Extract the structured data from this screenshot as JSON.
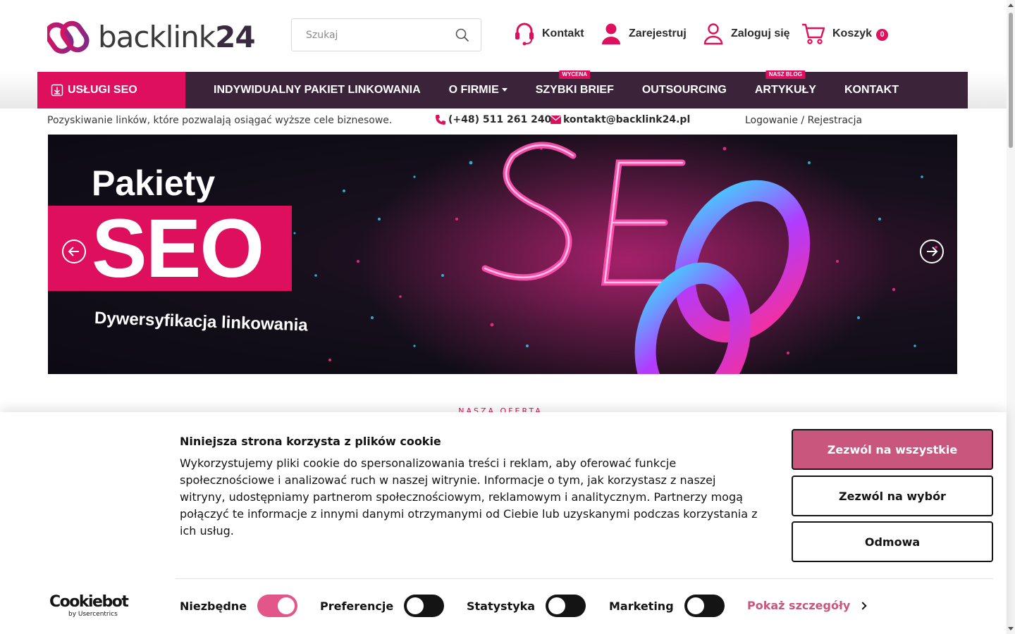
{
  "brand": {
    "logo_text": "backlink",
    "logo_number": "24"
  },
  "header": {
    "search_placeholder": "Szukaj",
    "kontakt": "Kontakt",
    "register": "Zarejestruj",
    "login": "Zaloguj się",
    "cart": "Koszyk",
    "cart_count": "0"
  },
  "nav": {
    "seo_services": "USŁUGI SEO",
    "items": [
      {
        "label": "INDYWIDUALNY PAKIET LINKOWANIA",
        "badge": ""
      },
      {
        "label": "O FIRMIE",
        "badge": ""
      },
      {
        "label": "SZYBKI BRIEF",
        "badge": "WYCENA"
      },
      {
        "label": "OUTSOURCING",
        "badge": ""
      },
      {
        "label": "ARTYKUŁY",
        "badge": "NASZ BLOG"
      },
      {
        "label": "KONTAKT",
        "badge": ""
      }
    ]
  },
  "infobar": {
    "tagline": "Pozyskiwanie linków, które pozwalają osiągać wyższe cele biznesowe.",
    "phone": "(+48) 511 261 240",
    "email": "kontakt@backlink24.pl",
    "login_register": "Logowanie / Rejestracja"
  },
  "banner": {
    "title_line1": "Pakiety",
    "title_line2": "SEO",
    "subtitle": "Dywersyfikacja linkowania"
  },
  "section": {
    "offer_label": "NASZA OFERTA"
  },
  "cookie": {
    "title": "Niniejsza strona korzysta z plików cookie",
    "text": "Wykorzystujemy pliki cookie do spersonalizowania treści i reklam, aby oferować funkcje społecznościowe i analizować ruch w naszej witrynie. Informacje o tym, jak korzystasz z naszej witryny, udostępniamy partnerom społecznościowym, reklamowym i analitycznym. Partnerzy mogą połączyć te informacje z innymi danymi otrzymanymi od Ciebie lub uzyskanymi podczas korzystania z ich usług.",
    "allow_all": "Zezwól na wszystkie",
    "allow_selection": "Zezwól na wybór",
    "deny": "Odmowa",
    "provider_logo": "Cookiebot",
    "provider_sub": "by Usercentrics",
    "toggles": [
      {
        "label": "Niezbędne",
        "on": true
      },
      {
        "label": "Preferencje",
        "on": false
      },
      {
        "label": "Statystyka",
        "on": false
      },
      {
        "label": "Marketing",
        "on": false
      }
    ],
    "details": "Pokaż szczegóły"
  },
  "colors": {
    "accent": "#de0f5c",
    "nav_bg": "#3b2339",
    "cookie_accent": "#c9567d"
  }
}
